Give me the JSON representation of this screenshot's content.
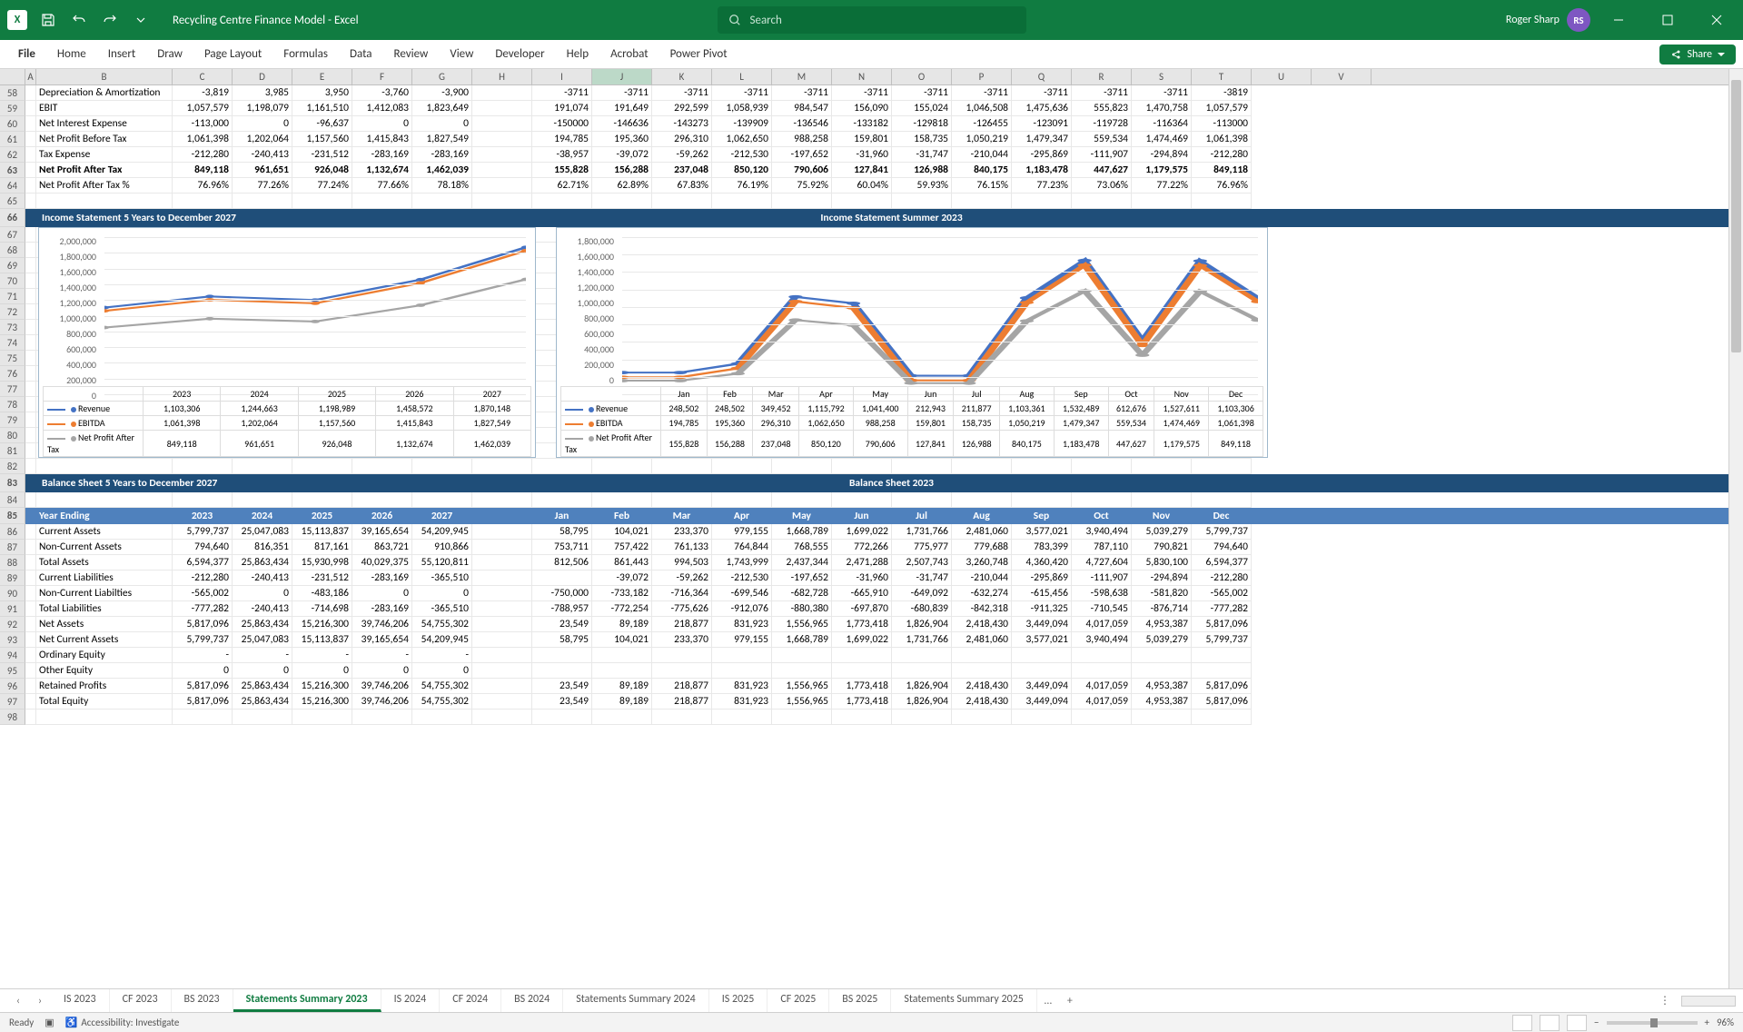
{
  "title": "Recycling Centre Finance Model  -  Excel",
  "search_placeholder": "Search",
  "user": {
    "name": "Roger Sharp",
    "initials": "RS"
  },
  "ribbon_tabs": [
    "File",
    "Home",
    "Insert",
    "Draw",
    "Page Layout",
    "Formulas",
    "Data",
    "Review",
    "View",
    "Developer",
    "Help",
    "Acrobat",
    "Power Pivot"
  ],
  "share_label": "Share",
  "columns": [
    "A",
    "B",
    "C",
    "D",
    "E",
    "F",
    "G",
    "H",
    "I",
    "J",
    "K",
    "L",
    "M",
    "N",
    "O",
    "P",
    "Q",
    "R",
    "S",
    "T",
    "U",
    "V"
  ],
  "active_col": "J",
  "row_start": 58,
  "upper_rows": [
    {
      "r": 58,
      "label": "Depreciation & Amortization",
      "vals": [
        "-3,819",
        "3,985",
        "3,950",
        "-3,760",
        "-3,900",
        "",
        "-3711",
        "-3711",
        "-3711",
        "-3711",
        "-3711",
        "-3711",
        "-3711",
        "-3711",
        "-3711",
        "-3711",
        "-3711",
        "-3819"
      ]
    },
    {
      "r": 59,
      "label": "EBIT",
      "vals": [
        "1,057,579",
        "1,198,079",
        "1,161,510",
        "1,412,083",
        "1,823,649",
        "",
        "191,074",
        "191,649",
        "292,599",
        "1,058,939",
        "984,547",
        "156,090",
        "155,024",
        "1,046,508",
        "1,475,636",
        "555,823",
        "1,470,758",
        "1,057,579"
      ]
    },
    {
      "r": 60,
      "label": "Net Interest Expense",
      "vals": [
        "-113,000",
        "0",
        "-96,637",
        "0",
        "0",
        "",
        "-150000",
        "-146636",
        "-143273",
        "-139909",
        "-136546",
        "-133182",
        "-129818",
        "-126455",
        "-123091",
        "-119728",
        "-116364",
        "-113000"
      ]
    },
    {
      "r": 61,
      "label": "Net Profit Before Tax",
      "vals": [
        "1,061,398",
        "1,202,064",
        "1,157,560",
        "1,415,843",
        "1,827,549",
        "",
        "194,785",
        "195,360",
        "296,310",
        "1,062,650",
        "988,258",
        "159,801",
        "158,735",
        "1,050,219",
        "1,479,347",
        "559,534",
        "1,474,469",
        "1,061,398"
      ]
    },
    {
      "r": 62,
      "label": "Tax Expense",
      "vals": [
        "-212,280",
        "-240,413",
        "-231,512",
        "-283,169",
        "-283,169",
        "",
        "-38,957",
        "-39,072",
        "-59,262",
        "-212,530",
        "-197,652",
        "-31,960",
        "-31,747",
        "-210,044",
        "-295,869",
        "-111,907",
        "-294,894",
        "-212,280"
      ]
    },
    {
      "r": 63,
      "label": "Net Profit After Tax",
      "bold": true,
      "vals": [
        "849,118",
        "961,651",
        "926,048",
        "1,132,674",
        "1,462,039",
        "",
        "155,828",
        "156,288",
        "237,048",
        "850,120",
        "790,606",
        "127,841",
        "126,988",
        "840,175",
        "1,183,478",
        "447,627",
        "1,179,575",
        "849,118"
      ]
    },
    {
      "r": 64,
      "label": "Net Profit After Tax %",
      "vals": [
        "76.96%",
        "77.26%",
        "77.24%",
        "77.66%",
        "78.18%",
        "",
        "62.71%",
        "62.89%",
        "67.83%",
        "76.19%",
        "75.92%",
        "60.04%",
        "59.93%",
        "76.15%",
        "77.23%",
        "73.06%",
        "77.22%",
        "76.96%"
      ]
    }
  ],
  "blank_rows_1": [
    65
  ],
  "section1": {
    "left": "Income Statement 5 Years to December 2027",
    "right": "Income Statement Summer 2023",
    "row": 66
  },
  "chart_rows": [
    67,
    68,
    69,
    70,
    71,
    72,
    73,
    74,
    75,
    76,
    77,
    78,
    79,
    80,
    81,
    82
  ],
  "section2": {
    "left": "Balance Sheet 5 Years to December 2027",
    "right": "Balance Sheet 2023",
    "row": 83
  },
  "blank_rows_2": [
    84
  ],
  "year_header": {
    "r": 85,
    "label": "Year Ending",
    "vals": [
      "2023",
      "2024",
      "2025",
      "2026",
      "2027",
      "",
      "Jan",
      "Feb",
      "Mar",
      "Apr",
      "May",
      "Jun",
      "Jul",
      "Aug",
      "Sep",
      "Oct",
      "Nov",
      "Dec"
    ]
  },
  "bs_rows": [
    {
      "r": 86,
      "label": "Current Assets",
      "vals": [
        "5,799,737",
        "25,047,083",
        "15,113,837",
        "39,165,654",
        "54,209,945",
        "",
        "58,795",
        "104,021",
        "233,370",
        "979,155",
        "1,668,789",
        "1,699,022",
        "1,731,766",
        "2,481,060",
        "3,577,021",
        "3,940,494",
        "5,039,279",
        "5,799,737"
      ]
    },
    {
      "r": 87,
      "label": "Non-Current Assets",
      "vals": [
        "794,640",
        "816,351",
        "817,161",
        "863,721",
        "910,866",
        "",
        "753,711",
        "757,422",
        "761,133",
        "764,844",
        "768,555",
        "772,266",
        "775,977",
        "779,688",
        "783,399",
        "787,110",
        "790,821",
        "794,640"
      ]
    },
    {
      "r": 88,
      "label": "Total Assets",
      "vals": [
        "6,594,377",
        "25,863,434",
        "15,930,998",
        "40,029,375",
        "55,120,811",
        "",
        "812,506",
        "861,443",
        "994,503",
        "1,743,999",
        "2,437,344",
        "2,471,288",
        "2,507,743",
        "3,260,748",
        "4,360,420",
        "4,727,604",
        "5,830,100",
        "6,594,377"
      ]
    },
    {
      "r": 89,
      "label": "Current Liabilities",
      "vals": [
        "-212,280",
        "-240,413",
        "-231,512",
        "-283,169",
        "-365,510",
        "",
        "",
        "-39,072",
        "-59,262",
        "-212,530",
        "-197,652",
        "-31,960",
        "-31,747",
        "-210,044",
        "-295,869",
        "-111,907",
        "-294,894",
        "-212,280"
      ]
    },
    {
      "r": 90,
      "label": "Non-Current Liabilties",
      "vals": [
        "-565,002",
        "0",
        "-483,186",
        "0",
        "0",
        "",
        "-750,000",
        "-733,182",
        "-716,364",
        "-699,546",
        "-682,728",
        "-665,910",
        "-649,092",
        "-632,274",
        "-615,456",
        "-598,638",
        "-581,820",
        "-565,002"
      ]
    },
    {
      "r": 91,
      "label": "Total Liabilities",
      "vals": [
        "-777,282",
        "-240,413",
        "-714,698",
        "-283,169",
        "-365,510",
        "",
        "-788,957",
        "-772,254",
        "-775,626",
        "-912,076",
        "-880,380",
        "-697,870",
        "-680,839",
        "-842,318",
        "-911,325",
        "-710,545",
        "-876,714",
        "-777,282"
      ]
    },
    {
      "r": 92,
      "label": "Net Assets",
      "vals": [
        "5,817,096",
        "25,863,434",
        "15,216,300",
        "39,746,206",
        "54,755,302",
        "",
        "23,549",
        "89,189",
        "218,877",
        "831,923",
        "1,556,965",
        "1,773,418",
        "1,826,904",
        "2,418,430",
        "3,449,094",
        "4,017,059",
        "4,953,387",
        "5,817,096"
      ]
    },
    {
      "r": 93,
      "label": "Net Current Assets",
      "vals": [
        "5,799,737",
        "25,047,083",
        "15,113,837",
        "39,165,654",
        "54,209,945",
        "",
        "58,795",
        "104,021",
        "233,370",
        "979,155",
        "1,668,789",
        "1,699,022",
        "1,731,766",
        "2,481,060",
        "3,577,021",
        "3,940,494",
        "5,039,279",
        "5,799,737"
      ]
    },
    {
      "r": 94,
      "label": "Ordinary Equity",
      "vals": [
        "-",
        "-",
        "-",
        "-",
        "-",
        "",
        "",
        "",
        "",
        "",
        "",
        "",
        "",
        "",
        "",
        "",
        "",
        ""
      ]
    },
    {
      "r": 95,
      "label": "Other Equity",
      "vals": [
        "0",
        "0",
        "0",
        "0",
        "0",
        "",
        "",
        "",
        "",
        "",
        "",
        "",
        "",
        "",
        "",
        "",
        "",
        ""
      ]
    },
    {
      "r": 96,
      "label": "Retained Profits",
      "vals": [
        "5,817,096",
        "25,863,434",
        "15,216,300",
        "39,746,206",
        "54,755,302",
        "",
        "23,549",
        "89,189",
        "218,877",
        "831,923",
        "1,556,965",
        "1,773,418",
        "1,826,904",
        "2,418,430",
        "3,449,094",
        "4,017,059",
        "4,953,387",
        "5,817,096"
      ]
    },
    {
      "r": 97,
      "label": "Total Equity",
      "vals": [
        "5,817,096",
        "25,863,434",
        "15,216,300",
        "39,746,206",
        "54,755,302",
        "",
        "23,549",
        "89,189",
        "218,877",
        "831,923",
        "1,556,965",
        "1,773,418",
        "1,826,904",
        "2,418,430",
        "3,449,094",
        "4,017,059",
        "4,953,387",
        "5,817,096"
      ]
    }
  ],
  "blank_rows_3": [
    98
  ],
  "chart_data": [
    {
      "type": "line",
      "title": "Income Statement 5 Years to December 2027",
      "categories": [
        "2023",
        "2024",
        "2025",
        "2026",
        "2027"
      ],
      "ylim": [
        0,
        2000000
      ],
      "yticks": [
        "2,000,000",
        "1,800,000",
        "1,600,000",
        "1,400,000",
        "1,200,000",
        "1,000,000",
        "800,000",
        "600,000",
        "400,000",
        "200,000",
        "0"
      ],
      "series": [
        {
          "name": "Revenue",
          "color": "#4472c4",
          "values": [
            1103306,
            1244663,
            1198989,
            1458572,
            1870148
          ]
        },
        {
          "name": "EBITDA",
          "color": "#ed7d31",
          "values": [
            1061398,
            1202064,
            1157560,
            1415843,
            1827549
          ]
        },
        {
          "name": "Net Profit After Tax",
          "color": "#a5a5a5",
          "values": [
            849118,
            961651,
            926048,
            1132674,
            1462039
          ]
        }
      ]
    },
    {
      "type": "line",
      "title": "Income Statement Summer 2023",
      "categories": [
        "Jan",
        "Feb",
        "Mar",
        "Apr",
        "May",
        "Jun",
        "Jul",
        "Aug",
        "Sep",
        "Oct",
        "Nov",
        "Dec"
      ],
      "ylim": [
        0,
        1800000
      ],
      "yticks": [
        "1,800,000",
        "1,600,000",
        "1,400,000",
        "1,200,000",
        "1,000,000",
        "800,000",
        "600,000",
        "400,000",
        "200,000",
        "0"
      ],
      "series": [
        {
          "name": "Revenue",
          "color": "#4472c4",
          "values": [
            248502,
            248502,
            349452,
            1115792,
            1041400,
            212943,
            211877,
            1103361,
            1532489,
            612676,
            1527611,
            1103306
          ]
        },
        {
          "name": "EBITDA",
          "color": "#ed7d31",
          "values": [
            194785,
            195360,
            296310,
            1062650,
            988258,
            159801,
            158735,
            1050219,
            1479347,
            559534,
            1474469,
            1061398
          ]
        },
        {
          "name": "Net Profit After Tax",
          "color": "#a5a5a5",
          "values": [
            155828,
            156288,
            237048,
            850120,
            790606,
            127841,
            126988,
            840175,
            1183478,
            447627,
            1179575,
            849118
          ]
        }
      ]
    }
  ],
  "sheet_tabs": [
    "IS 2023",
    "CF 2023",
    "BS 2023",
    "Statements Summary 2023",
    "IS 2024",
    "CF 2024",
    "BS 2024",
    "Statements Summary 2024",
    "IS 2025",
    "CF 2025",
    "BS 2025",
    "Statements Summary 2025"
  ],
  "active_sheet": "Statements Summary 2023",
  "status": {
    "ready": "Ready",
    "access": "Accessibility: Investigate",
    "zoom": "96%"
  }
}
